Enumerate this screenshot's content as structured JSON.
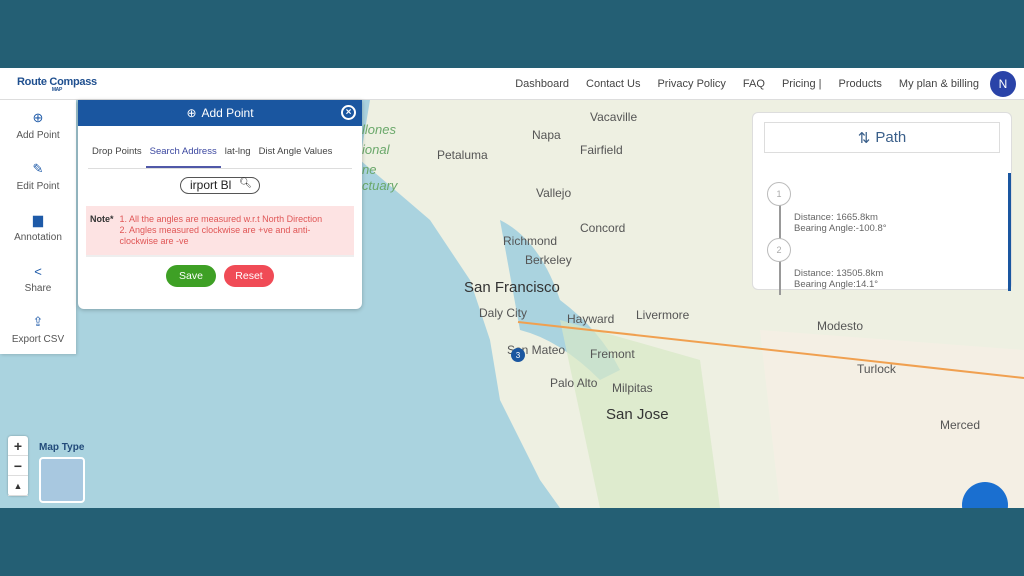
{
  "brand": {
    "name": "Route Compass",
    "sub": "MAP"
  },
  "nav": [
    "Dashboard",
    "Contact Us",
    "Privacy Policy",
    "FAQ",
    "Pricing |",
    "Products",
    "My plan & billing"
  ],
  "avatar": "N",
  "sidebar": [
    {
      "label": "Add Point",
      "icon": "plus-circle-icon"
    },
    {
      "label": "Edit Point",
      "icon": "pencil-icon"
    },
    {
      "label": "Annotation",
      "icon": "comment-icon"
    },
    {
      "label": "Share",
      "icon": "share-icon"
    },
    {
      "label": "Export CSV",
      "icon": "export-icon"
    }
  ],
  "panel": {
    "title": "Add Point",
    "tabs": [
      "Drop Points",
      "Search Address",
      "lat-lng",
      "Dist Angle Values"
    ],
    "active_tab": "Search Address",
    "search_value": "irport Bl",
    "note_label": "Note*",
    "note_lines": [
      "1. All the angles are measured w.r.t North Direction",
      "2. Angles measured clockwise are +ve and anti-",
      "clockwise are -ve"
    ],
    "save": "Save",
    "reset": "Reset"
  },
  "path": {
    "title": "Path",
    "steps": [
      {
        "n": "1",
        "distance": "Distance: 1665.8km",
        "bearing": "Bearing Angle:-100.8°"
      },
      {
        "n": "2",
        "distance": "Distance: 13505.8km",
        "bearing": "Bearing Angle:14.1°"
      }
    ]
  },
  "map": {
    "type_label": "Map Type",
    "marker": "3",
    "labels": {
      "napa": "Napa",
      "vacaville": "Vacaville",
      "petaluma": "Petaluma",
      "fairfield": "Fairfield",
      "vallejo": "Vallejo",
      "concord": "Concord",
      "richmond": "Richmond",
      "berkeley": "Berkeley",
      "sf": "San Francisco",
      "daly": "Daly City",
      "hayward": "Hayward",
      "livermore": "Livermore",
      "sanmateo": "San Mateo",
      "fremont": "Fremont",
      "paloalto": "Palo Alto",
      "milpitas": "Milpitas",
      "sanjose": "San Jose",
      "modesto": "Modesto",
      "turlock": "Turlock",
      "merced": "Merced",
      "s1": "llones",
      "s2": "ional",
      "s3": "ne",
      "s4": "ctuary"
    }
  },
  "colors": {
    "primary": "#1a56a0",
    "save": "#3ea025",
    "reset": "#f04b56",
    "route": "#f0a050"
  }
}
